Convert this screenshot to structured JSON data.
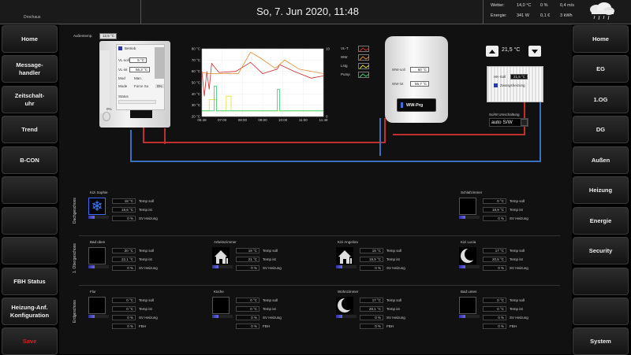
{
  "header": {
    "brand": "Drochaus",
    "datetime": "So, 7. Jun 2020, 11:48",
    "weather": {
      "wetter_label": "Wetter:",
      "energie_label": "Energie:",
      "temp": "14,0 °C",
      "hum": "0 %",
      "wind": "0,4 m/s",
      "power": "341 W",
      "cost": "0,1 €",
      "energy": "3 kWh"
    }
  },
  "left_nav": [
    {
      "label": "Home"
    },
    {
      "label": "Message-\nhandler"
    },
    {
      "label": "Zeitschalt-\nuhr"
    },
    {
      "label": "Trend"
    },
    {
      "label": "B-CON"
    },
    {
      "label": ""
    },
    {
      "label": ""
    },
    {
      "label": ""
    },
    {
      "label": "FBH Status"
    },
    {
      "label": "Heizung-Anf.\nKonfiguration"
    },
    {
      "label": "Save"
    }
  ],
  "right_nav": [
    {
      "label": "Home"
    },
    {
      "label": "EG"
    },
    {
      "label": "1.OG"
    },
    {
      "label": "DG"
    },
    {
      "label": "Außen"
    },
    {
      "label": "Heizung"
    },
    {
      "label": "Energie"
    },
    {
      "label": "Security"
    },
    {
      "label": ""
    },
    {
      "label": ""
    },
    {
      "label": "System"
    }
  ],
  "boiler": {
    "aussen_label": "Außentemp.",
    "aussen": "12,5 °C",
    "betrieb": "Betrieb",
    "vlsoll_label": "VL-soll",
    "vlsoll": "5 °C",
    "vlist_label": "VL-ist",
    "vlist": "56,3 °C",
    "mod_label": "Mod",
    "mod": "Man.",
    "mode_label": "Mode",
    "mode": "Force So",
    "pct": "0%",
    "status_label": "Status",
    "gauge": "0%"
  },
  "tank": {
    "wwsoll_label": "WW-soll",
    "wwsoll": "60 °C",
    "wwist_label": "WW-ist",
    "wwist": "56,7 °C",
    "btn": "WW-Prg"
  },
  "radiator": {
    "setpoint": "21,5 °C",
    "hksoll_label": "HK-Soll",
    "hksoll": "21,5 °C",
    "zwangsheizung": "Zwangsheizung",
    "sw_label": "So/W Umschaltung",
    "sw_value": "auto S/W"
  },
  "chart_data": {
    "type": "line",
    "x": [
      "05:48",
      "07:00",
      "08:00",
      "09:00",
      "10:00",
      "11:00",
      "11:48"
    ],
    "left_ticks": [
      "80 °C",
      "70 °C",
      "60 °C",
      "50 °C",
      "40 °C",
      "30 °C",
      "20 °C"
    ],
    "right_ticks": [
      "100",
      "",
      "",
      "",
      "",
      "",
      "0"
    ],
    "right_unit": "%",
    "ylim": [
      20,
      80
    ],
    "legend": [
      "VL-T",
      "WW",
      "Lstg",
      "Pump"
    ],
    "series": [
      {
        "name": "VL-T",
        "color": "#d02828",
        "values": [
          [
            0,
            60
          ],
          [
            2,
            38
          ],
          [
            4,
            60
          ],
          [
            6,
            44
          ],
          [
            8,
            67
          ],
          [
            14,
            59
          ],
          [
            28,
            60
          ],
          [
            40,
            68
          ],
          [
            50,
            58
          ],
          [
            62,
            62
          ],
          [
            64,
            66
          ],
          [
            76,
            60
          ],
          [
            90,
            54
          ],
          [
            100,
            56
          ]
        ]
      },
      {
        "name": "WW",
        "color": "#e08a2a",
        "values": [
          [
            0,
            59
          ],
          [
            6,
            58
          ],
          [
            30,
            58
          ],
          [
            40,
            77
          ],
          [
            48,
            72
          ],
          [
            60,
            63
          ],
          [
            62,
            64
          ],
          [
            68,
            70
          ],
          [
            80,
            62
          ],
          [
            100,
            58
          ]
        ]
      },
      {
        "name": "Lstg",
        "color": "#e0e030",
        "values": [
          [
            0,
            25
          ],
          [
            6,
            25
          ],
          [
            6,
            35
          ],
          [
            12,
            35
          ],
          [
            12,
            25
          ],
          [
            20,
            25
          ],
          [
            20,
            38
          ],
          [
            24,
            38
          ],
          [
            24,
            25
          ],
          [
            100,
            25
          ]
        ]
      },
      {
        "name": "Pump",
        "color": "#30d070",
        "values": [
          [
            0,
            25
          ],
          [
            10,
            25
          ],
          [
            10,
            47
          ],
          [
            12,
            47
          ],
          [
            12,
            25
          ],
          [
            62,
            25
          ],
          [
            62,
            44
          ],
          [
            64,
            44
          ],
          [
            64,
            25
          ],
          [
            100,
            25
          ]
        ]
      }
    ]
  },
  "sections": [
    {
      "name": "Dachgeschoss",
      "rooms": [
        {
          "name": "Kizi Sophie",
          "icon": "snowflake",
          "soll": "18 °C",
          "ist": "19,6 °C",
          "sv": "0 %",
          "soll_label": "Temp soll",
          "ist_label": "Temp ist",
          "sv_label": "SV Heizung"
        },
        {
          "name": "Schlafzimmer",
          "icon": "none",
          "soll": "0 °C",
          "ist": "18,9 °C",
          "sv": "0 %",
          "soll_label": "Temp soll",
          "ist_label": "Temp ist",
          "sv_label": "SV Heizung"
        }
      ]
    },
    {
      "name": "1. Obergeschoss",
      "rooms": [
        {
          "name": "Bad oben",
          "icon": "none",
          "soll": "20 °C",
          "ist": "22,1 °C",
          "sv": "0 %",
          "soll_label": "Temp soll",
          "ist_label": "Temp ist",
          "sv_label": "SV Heizung"
        },
        {
          "name": "Arbeitszimmer",
          "icon": "house",
          "soll": "19 °C",
          "ist": "21 °C",
          "sv": "0 %",
          "soll_label": "Temp soll",
          "ist_label": "Temp ist",
          "sv_label": "SV Heizung"
        },
        {
          "name": "Kizi Angelina",
          "icon": "house",
          "soll": "19 °C",
          "ist": "19,9 °C",
          "sv": "0 %",
          "soll_label": "Temp soll",
          "ist_label": "Temp ist",
          "sv_label": "SV Heizung"
        },
        {
          "name": "Kizi Lucia",
          "icon": "moon",
          "soll": "17 °C",
          "ist": "20,5 °C",
          "sv": "0 %",
          "soll_label": "Temp soll",
          "ist_label": "Temp ist",
          "sv_label": "SV Heizung"
        }
      ]
    },
    {
      "name": "Erdgeschoss",
      "rooms": [
        {
          "name": "Flur",
          "icon": "none",
          "soll": "0 °C",
          "ist": "0 °C",
          "sv": "0 %",
          "fbh": "0 %",
          "soll_label": "Temp soll",
          "ist_label": "Temp ist",
          "sv_label": "SV Heizung",
          "fbh_label": "FBH"
        },
        {
          "name": "Küche",
          "icon": "none",
          "soll": "0 °C",
          "ist": "0 °C",
          "sv": "0 %",
          "fbh": "0 %",
          "soll_label": "Temp soll",
          "ist_label": "Temp ist",
          "sv_label": "SV Heizung",
          "fbh_label": "FBH"
        },
        {
          "name": "Wohnzimmer",
          "icon": "moon",
          "soll": "17 °C",
          "ist": "20,1 °C",
          "sv": "0 %",
          "fbh": "0 %",
          "soll_label": "Temp soll",
          "ist_label": "Temp ist",
          "sv_label": "SV Heizung",
          "fbh_label": "FBH"
        },
        {
          "name": "Bad unten",
          "icon": "none",
          "soll": "0 °C",
          "ist": "0 °C",
          "sv": "0 %",
          "fbh": "0 %",
          "soll_label": "Temp soll",
          "ist_label": "Temp ist",
          "sv_label": "SV Heizung",
          "fbh_label": "FBH"
        }
      ]
    }
  ]
}
